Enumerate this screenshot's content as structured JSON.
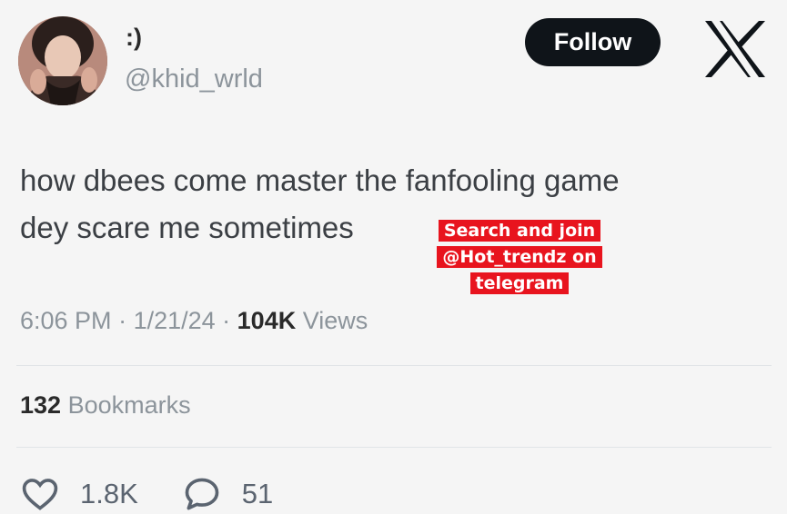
{
  "user": {
    "display_name": ":)",
    "handle": "@khid_wrld"
  },
  "header": {
    "follow_label": "Follow",
    "logo_icon": "x-logo-icon"
  },
  "tweet": {
    "line1": "how dbees come master the fanfooling game",
    "line2": "dey scare me sometimes"
  },
  "overlay": {
    "line1": "Search and join",
    "line2": "@Hot_trendz on",
    "line3": "telegram",
    "color": "#e8141e"
  },
  "meta": {
    "time": "6:06 PM",
    "sep1": " · ",
    "date": "1/21/24",
    "sep2": " · ",
    "views_count": "104K",
    "views_label": " Views"
  },
  "bookmarks": {
    "count": "132",
    "label": " Bookmarks"
  },
  "actions": {
    "likes": "1.8K",
    "replies": "51"
  }
}
